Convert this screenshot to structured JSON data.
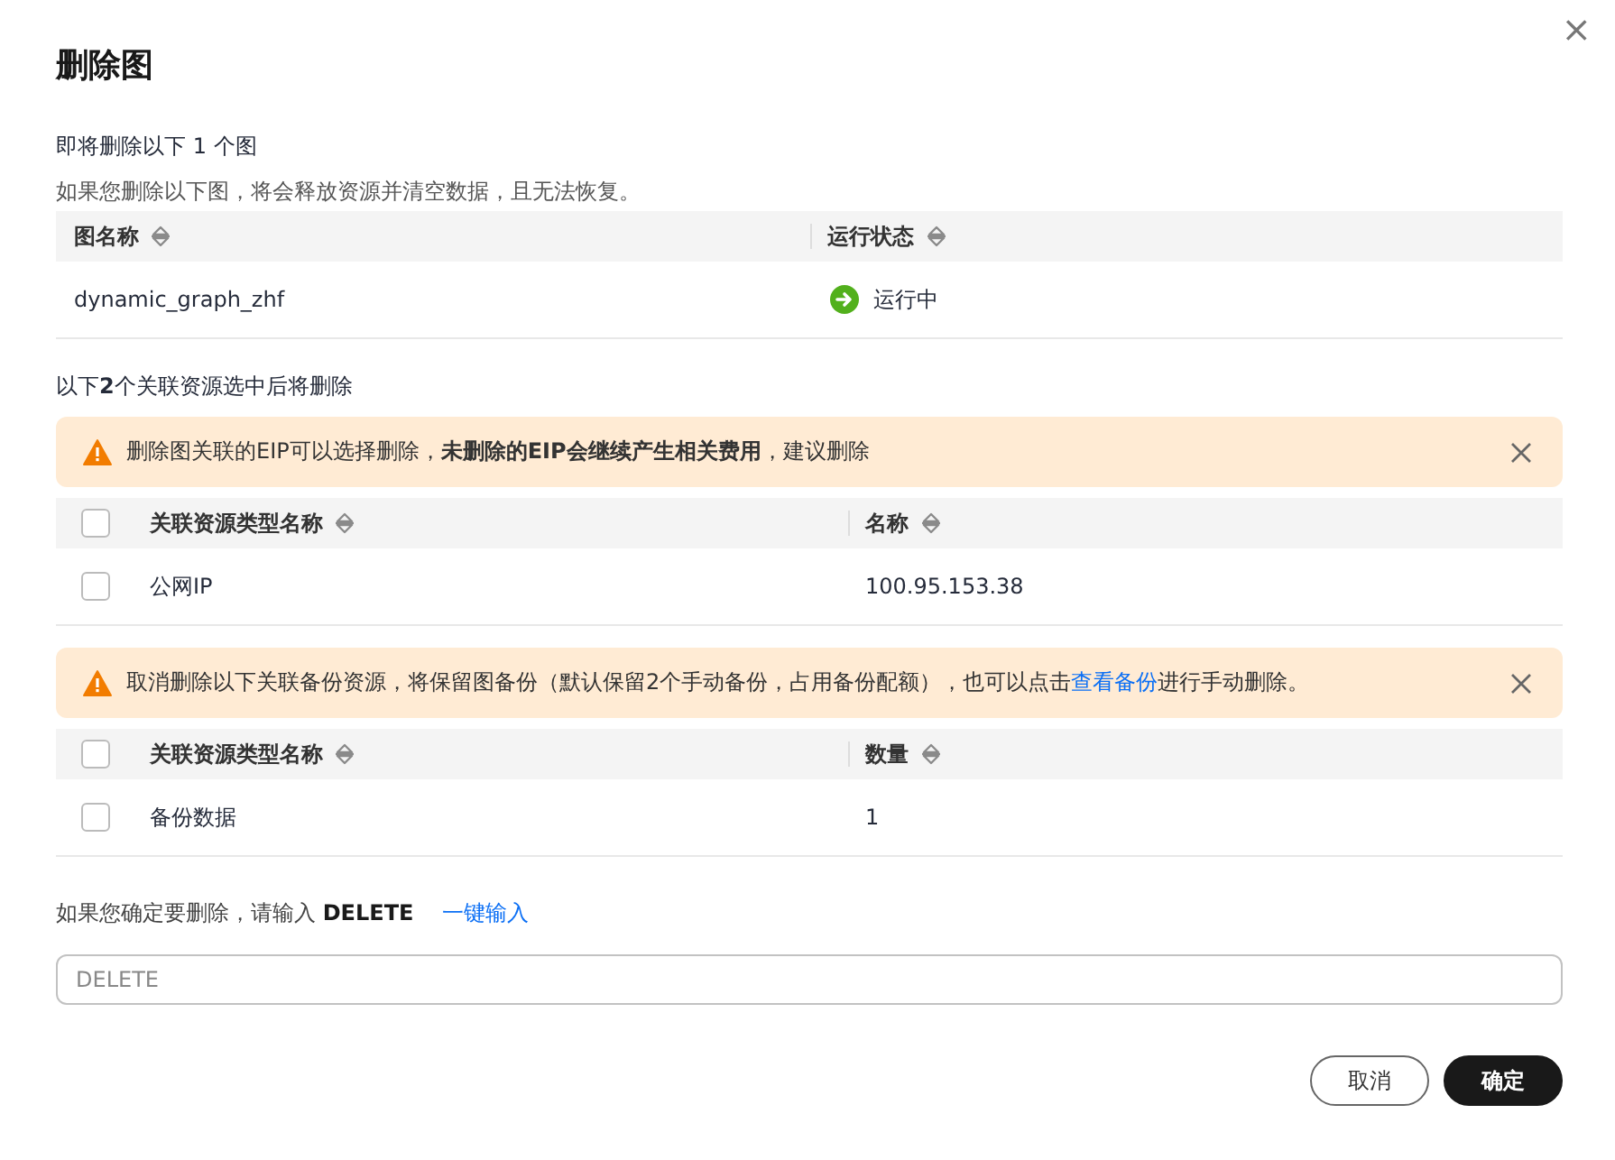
{
  "dialog": {
    "title": "删除图",
    "close": "×"
  },
  "intro": {
    "heading": "即将删除以下 1 个图",
    "warning": "如果您删除以下图，将会释放资源并清空数据，且无法恢复。"
  },
  "graph_table": {
    "columns": [
      "图名称",
      "运行状态"
    ],
    "rows": [
      {
        "name": "dynamic_graph_zhf",
        "status": {
          "kind": "running",
          "text": "运行中"
        }
      }
    ]
  },
  "related_note": "以下**2**个关联资源选中后将删除",
  "sections": [
    {
      "alert": {
        "message": "删除图关联的EIP可以选择删除，**未删除的EIP会继续产生相关费用**，建议删除"
      },
      "table": {
        "header_checked": false,
        "columns": [
          "关联资源类型名称",
          "名称"
        ],
        "rows": [
          {
            "checked": false,
            "cells": [
              "公网IP",
              "100.95.153.38"
            ]
          }
        ]
      }
    },
    {
      "alert": {
        "message": "取消删除以下关联备份资源，将保留图备份（默认保留2个手动备份，占用备份配额），也可以点击",
        "link": "查看备份",
        "message_end": "进行手动删除。"
      },
      "table": {
        "header_checked": false,
        "columns": [
          "关联资源类型名称",
          "数量"
        ],
        "rows": [
          {
            "checked": false,
            "cells": [
              "备份数据",
              "1"
            ]
          }
        ]
      }
    }
  ],
  "confirm": {
    "prompt": "如果您确定要删除，请输入 **DELETE**",
    "autofill_link": "一键输入",
    "placeholder": "DELETE"
  },
  "buttons": [
    {
      "label": "取消",
      "kind": "secondary"
    },
    {
      "label": "确定",
      "kind": "primary"
    }
  ]
}
